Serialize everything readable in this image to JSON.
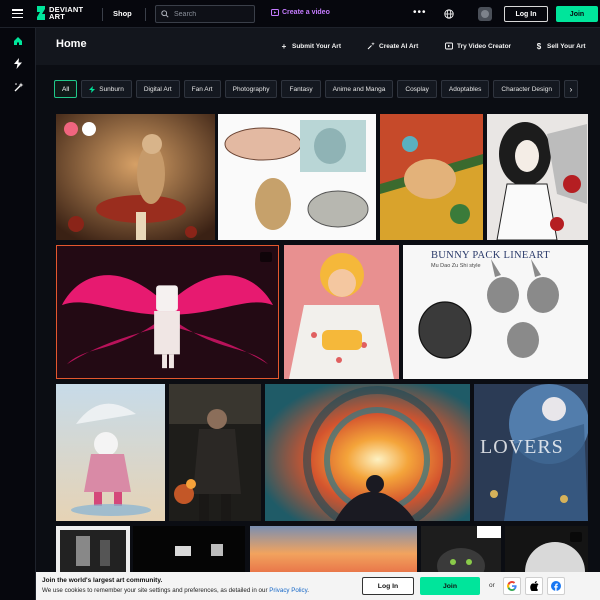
{
  "topbar": {
    "logo_line1": "DEVIANT",
    "logo_line2": "ART",
    "shop": "Shop",
    "search_placeholder": "Search",
    "create_video": "Create a video",
    "login": "Log In",
    "join": "Join"
  },
  "header": {
    "title": "Home",
    "actions": [
      {
        "label": "Submit Your Art",
        "icon": "plus-icon"
      },
      {
        "label": "Create AI Art",
        "icon": "sparkle-icon"
      },
      {
        "label": "Try Video Creator",
        "icon": "video-icon"
      },
      {
        "label": "Sell Your Art",
        "icon": "dollar-icon"
      }
    ]
  },
  "filters": [
    "All",
    "Sunburn",
    "Digital Art",
    "Fan Art",
    "Photography",
    "Fantasy",
    "Anime and Manga",
    "Cosplay",
    "Adoptables",
    "Character Design"
  ],
  "gallery": {
    "bunny_title": "BUNNY PACK LINEART",
    "bunny_subtitle": "Mu Dao Zu Shi style",
    "lovers_text": "LOVERS"
  },
  "cookie": {
    "title": "Join the world's largest art community.",
    "text": "We use cookies to remember your site settings and preferences, as detailed in our ",
    "link": "Privacy Policy",
    "period": ".",
    "login": "Log In",
    "join": "Join",
    "or": "or"
  },
  "colors": {
    "accent": "#00e59b",
    "create_video": "#c57cff",
    "background": "#06070d"
  }
}
